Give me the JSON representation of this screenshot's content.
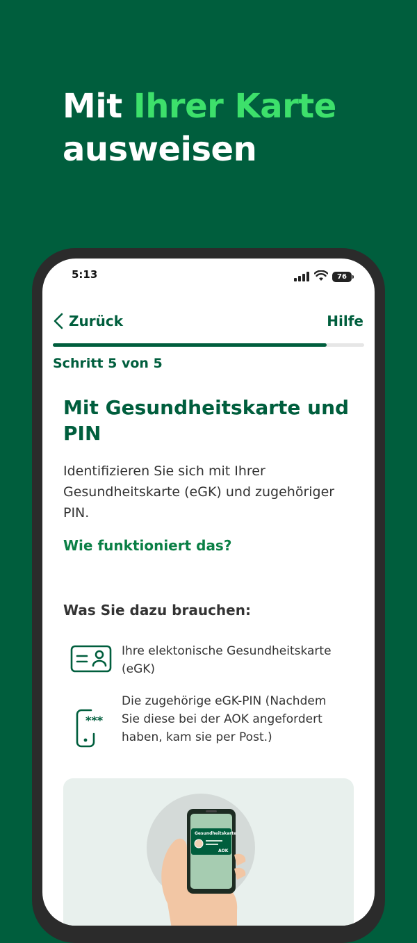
{
  "headline": {
    "part1": "Mit ",
    "accent": "Ihrer Karte",
    "part2": "ausweisen"
  },
  "status": {
    "time": "5:13",
    "battery": "76"
  },
  "nav": {
    "back_label": "Zurück",
    "help_label": "Hilfe"
  },
  "progress": {
    "current": 5,
    "total": 5,
    "fill_fraction": 0.88
  },
  "step_label": "Schritt 5 von 5",
  "content": {
    "title": "Mit Gesundheitskarte und PIN",
    "description": "Identifizieren Sie sich mit Ihrer Gesundheitskarte (eGK) und zugehöriger PIN.",
    "howto_link": "Wie funktioniert das?",
    "needs_heading": "Was Sie dazu brauchen:",
    "needs": [
      {
        "icon": "health-card-icon",
        "text": "Ihre elektonische Gesundheitskarte (eGK)"
      },
      {
        "icon": "phone-pin-icon",
        "text": "Die zugehörige eGK-PIN (Nachdem Sie diese bei der AOK angefordert haben, kam sie per Post.)"
      }
    ]
  },
  "illustration": {
    "card_title": "Gesundheitskarte",
    "card_brand": "AOK"
  },
  "colors": {
    "brand_dark": "#005e3d",
    "accent_green": "#3de06b",
    "link_green": "#0a7f45"
  }
}
